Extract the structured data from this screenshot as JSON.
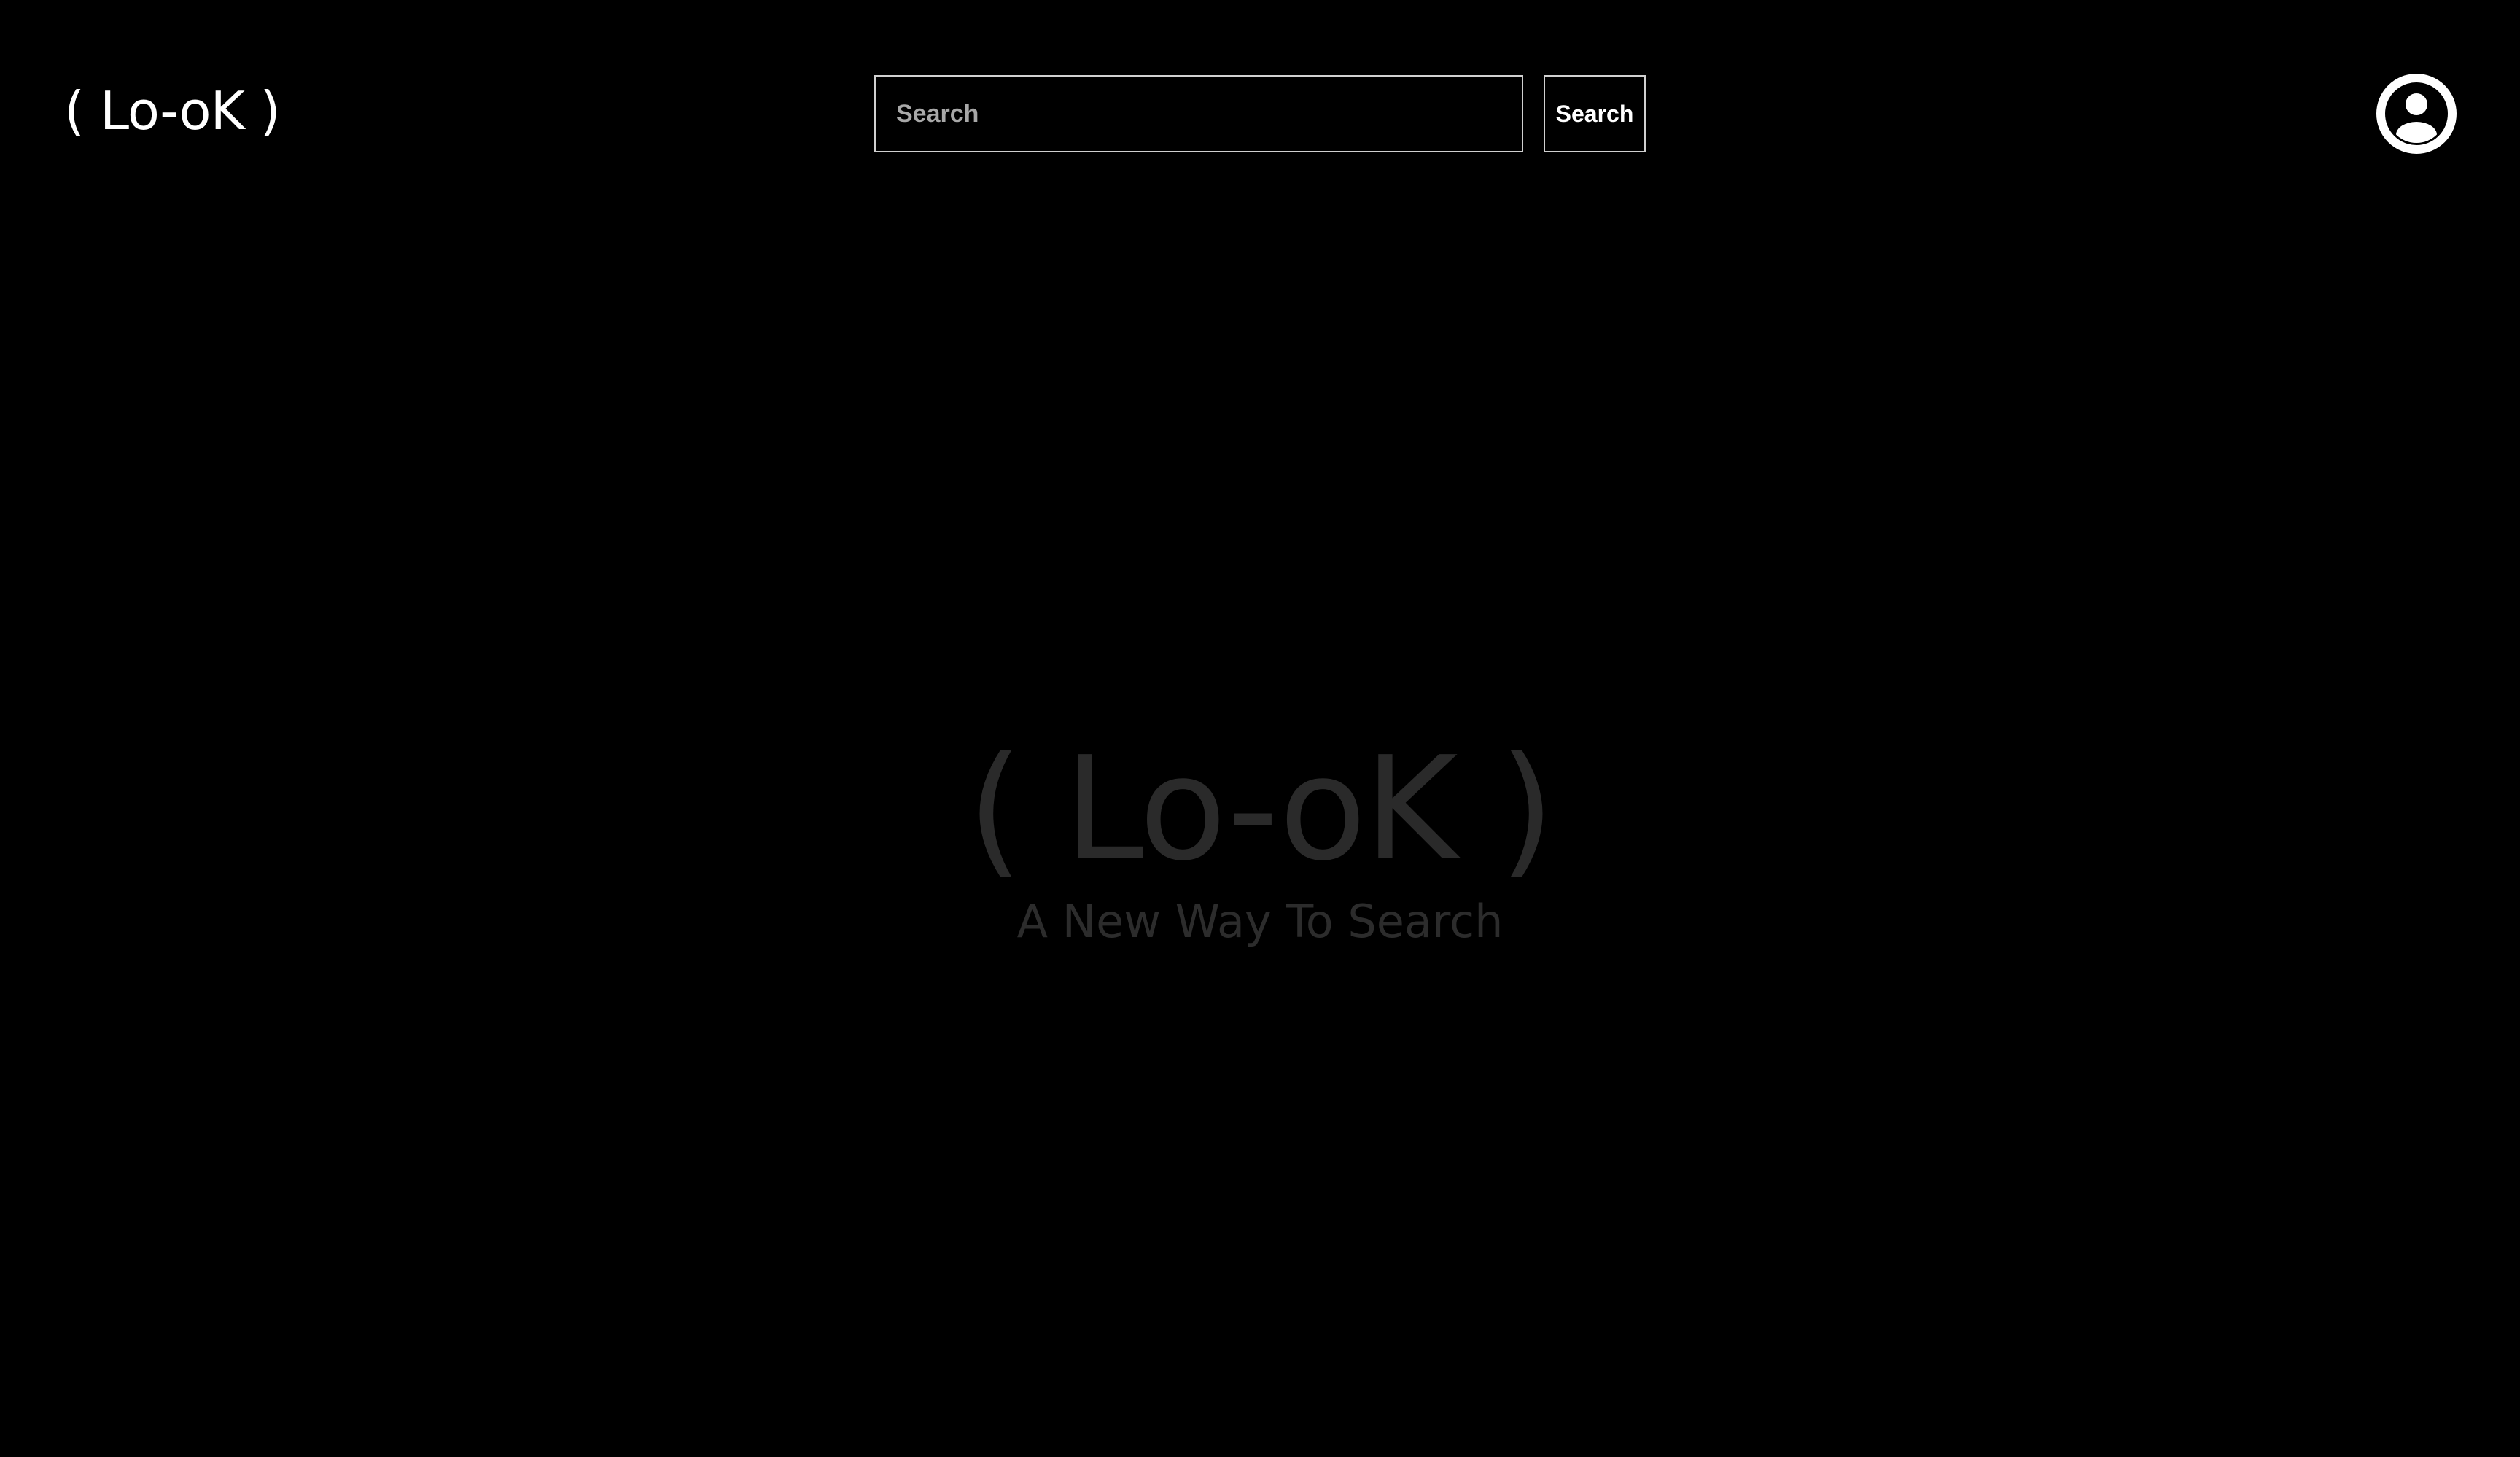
{
  "header": {
    "logo_text": "( Lo-oK )",
    "search": {
      "placeholder": "Search",
      "value": "",
      "button_label": "Search"
    },
    "account_icon": "user-circle-icon"
  },
  "hero": {
    "title": "( Lo-oK )",
    "tagline": "A New Way To Search"
  },
  "colors": {
    "background": "#000000",
    "foreground": "#ffffff",
    "hero_text": "#2a2a2a",
    "field_border": "#d0d0d0",
    "placeholder": "#a8a8a8"
  }
}
